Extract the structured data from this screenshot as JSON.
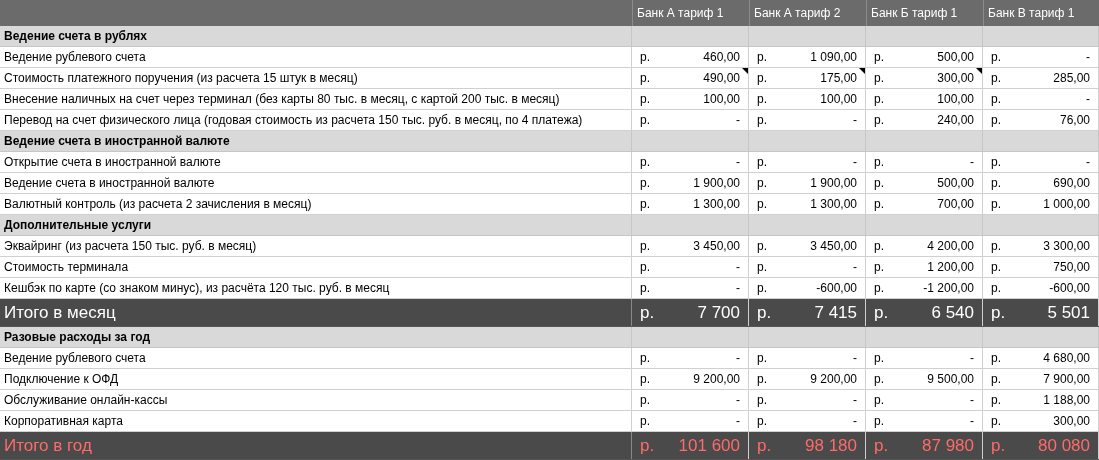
{
  "columns": [
    "Банк А тариф 1",
    "Банк А тариф 2",
    "Банк Б тариф 1",
    "Банк В тариф 1"
  ],
  "rows": [
    {
      "kind": "section",
      "label": "Ведение счета в рублях"
    },
    {
      "kind": "item",
      "label": "Ведение рублевого счета",
      "cells": [
        {
          "cur": "р.",
          "value": "460,00",
          "note": false
        },
        {
          "cur": "р.",
          "value": "1 090,00",
          "note": false
        },
        {
          "cur": "р.",
          "value": "500,00",
          "note": false
        },
        {
          "cur": "р.",
          "value": "-",
          "note": false
        }
      ]
    },
    {
      "kind": "item",
      "label": "Стоимость платежного поручения (из расчета 15 штук в месяц)",
      "cells": [
        {
          "cur": "р.",
          "value": "490,00",
          "note": true
        },
        {
          "cur": "р.",
          "value": "175,00",
          "note": true
        },
        {
          "cur": "р.",
          "value": "300,00",
          "note": true
        },
        {
          "cur": "р.",
          "value": "285,00",
          "note": false
        }
      ]
    },
    {
      "kind": "item",
      "label": "Внесение наличных на счет через терминал (без карты 80 тыс. в месяц, с картой 200 тыс. в месяц)",
      "cells": [
        {
          "cur": "р.",
          "value": "100,00",
          "note": false
        },
        {
          "cur": "р.",
          "value": "100,00",
          "note": false
        },
        {
          "cur": "р.",
          "value": "100,00",
          "note": false
        },
        {
          "cur": "р.",
          "value": "-",
          "note": false
        }
      ]
    },
    {
      "kind": "item",
      "label": "Перевод на счет физического лица (годовая стоимость из расчета 150 тыс. руб. в месяц, по 4 платежа)",
      "cells": [
        {
          "cur": "р.",
          "value": "-",
          "note": false
        },
        {
          "cur": "р.",
          "value": "-",
          "note": false
        },
        {
          "cur": "р.",
          "value": "240,00",
          "note": false
        },
        {
          "cur": "р.",
          "value": "76,00",
          "note": false
        }
      ]
    },
    {
      "kind": "section",
      "label": "Ведение счета в иностранной валюте"
    },
    {
      "kind": "item",
      "label": "Открытие счета в иностранной валюте",
      "cells": [
        {
          "cur": "р.",
          "value": "-",
          "note": false
        },
        {
          "cur": "р.",
          "value": "-",
          "note": false
        },
        {
          "cur": "р.",
          "value": "-",
          "note": false
        },
        {
          "cur": "р.",
          "value": "-",
          "note": false
        }
      ]
    },
    {
      "kind": "item",
      "label": "Ведение счета в иностранной валюте",
      "cells": [
        {
          "cur": "р.",
          "value": "1 900,00",
          "note": false
        },
        {
          "cur": "р.",
          "value": "1 900,00",
          "note": false
        },
        {
          "cur": "р.",
          "value": "500,00",
          "note": false
        },
        {
          "cur": "р.",
          "value": "690,00",
          "note": false
        }
      ]
    },
    {
      "kind": "item",
      "label": "Валютный контроль (из расчета 2 зачисления в месяц)",
      "cells": [
        {
          "cur": "р.",
          "value": "1 300,00",
          "note": false
        },
        {
          "cur": "р.",
          "value": "1 300,00",
          "note": false
        },
        {
          "cur": "р.",
          "value": "700,00",
          "note": false
        },
        {
          "cur": "р.",
          "value": "1 000,00",
          "note": false
        }
      ]
    },
    {
      "kind": "section",
      "label": "Дополнительные услуги"
    },
    {
      "kind": "item",
      "label": "Эквайринг (из расчета 150 тыс. руб. в месяц)",
      "cells": [
        {
          "cur": "р.",
          "value": "3 450,00",
          "note": false
        },
        {
          "cur": "р.",
          "value": "3 450,00",
          "note": false
        },
        {
          "cur": "р.",
          "value": "4 200,00",
          "note": false
        },
        {
          "cur": "р.",
          "value": "3 300,00",
          "note": false
        }
      ]
    },
    {
      "kind": "item",
      "label": "Стоимость терминала",
      "cells": [
        {
          "cur": "р.",
          "value": "-",
          "note": false
        },
        {
          "cur": "р.",
          "value": "-",
          "note": false
        },
        {
          "cur": "р.",
          "value": "1 200,00",
          "note": false
        },
        {
          "cur": "р.",
          "value": "750,00",
          "note": false
        }
      ]
    },
    {
      "kind": "item",
      "label": "Кешбэк по карте (со знаком минус), из расчёта 120 тыс. руб. в месяц",
      "cells": [
        {
          "cur": "р.",
          "value": "-",
          "note": false
        },
        {
          "cur": "р.",
          "value": "-600,00",
          "note": false
        },
        {
          "cur": "р.",
          "value": "-1 200,00",
          "note": false
        },
        {
          "cur": "р.",
          "value": "-600,00",
          "note": false
        }
      ]
    },
    {
      "kind": "total",
      "label": "Итого в месяц",
      "highlight": false,
      "cells": [
        {
          "cur": "р.",
          "value": "7 700",
          "note": false
        },
        {
          "cur": "р.",
          "value": "7 415",
          "note": false
        },
        {
          "cur": "р.",
          "value": "6 540",
          "note": false
        },
        {
          "cur": "р.",
          "value": "5 501",
          "note": false
        }
      ]
    },
    {
      "kind": "section",
      "label": "Разовые расходы за год"
    },
    {
      "kind": "item",
      "label": "Ведение рублевого счета",
      "cells": [
        {
          "cur": "р.",
          "value": "-",
          "note": false
        },
        {
          "cur": "р.",
          "value": "-",
          "note": false
        },
        {
          "cur": "р.",
          "value": "-",
          "note": false
        },
        {
          "cur": "р.",
          "value": "4 680,00",
          "note": false
        }
      ]
    },
    {
      "kind": "item",
      "label": "Подключение к ОФД",
      "cells": [
        {
          "cur": "р.",
          "value": "9 200,00",
          "note": false
        },
        {
          "cur": "р.",
          "value": "9 200,00",
          "note": false
        },
        {
          "cur": "р.",
          "value": "9 500,00",
          "note": false
        },
        {
          "cur": "р.",
          "value": "7 900,00",
          "note": false
        }
      ]
    },
    {
      "kind": "item",
      "label": "Обслуживание онлайн-кассы",
      "cells": [
        {
          "cur": "р.",
          "value": "-",
          "note": false
        },
        {
          "cur": "р.",
          "value": "-",
          "note": false
        },
        {
          "cur": "р.",
          "value": "-",
          "note": false
        },
        {
          "cur": "р.",
          "value": "1 188,00",
          "note": false
        }
      ]
    },
    {
      "kind": "item",
      "label": "Корпоративная карта",
      "cells": [
        {
          "cur": "р.",
          "value": "-",
          "note": false
        },
        {
          "cur": "р.",
          "value": "-",
          "note": false
        },
        {
          "cur": "р.",
          "value": "-",
          "note": false
        },
        {
          "cur": "р.",
          "value": "300,00",
          "note": false
        }
      ]
    },
    {
      "kind": "total",
      "label": "Итого в год",
      "highlight": true,
      "cells": [
        {
          "cur": "р.",
          "value": "101 600",
          "note": false
        },
        {
          "cur": "р.",
          "value": "98 180",
          "note": false
        },
        {
          "cur": "р.",
          "value": "87 980",
          "note": false
        },
        {
          "cur": "р.",
          "value": "80 080",
          "note": false
        }
      ]
    }
  ]
}
